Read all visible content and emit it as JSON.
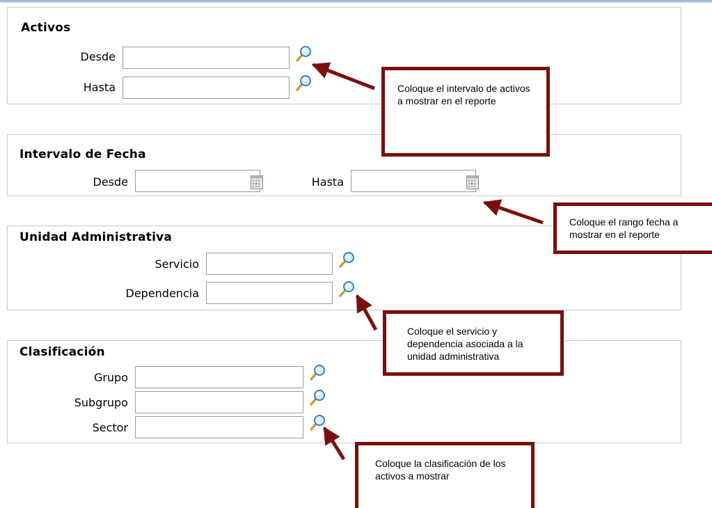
{
  "sections": {
    "activos": {
      "title": "Activos",
      "desde_label": "Desde",
      "hasta_label": "Hasta",
      "desde_value": "",
      "hasta_value": ""
    },
    "fecha": {
      "title": "Intervalo de Fecha",
      "desde_label": "Desde",
      "hasta_label": "Hasta",
      "desde_value": "",
      "hasta_value": ""
    },
    "unidad": {
      "title": "Unidad Administrativa",
      "servicio_label": "Servicio",
      "dependencia_label": "Dependencia",
      "servicio_value": "",
      "dependencia_value": ""
    },
    "clasificacion": {
      "title": "Clasificación",
      "grupo_label": "Grupo",
      "subgrupo_label": "Subgrupo",
      "sector_label": "Sector",
      "grupo_value": "",
      "subgrupo_value": "",
      "sector_value": ""
    }
  },
  "notes": {
    "activos": "Coloque el intervalo de activos a mostrar en el reporte",
    "fecha": "Coloque el rango fecha a mostrar en el reporte",
    "unidad": "Coloque el servicio y dependencia asociada a la unidad administrativa",
    "clasificacion": "Coloque la clasificación de los activos a mostrar"
  },
  "colors": {
    "annotation": "#7a0f0f",
    "panel_border": "#c8c8c8",
    "search_icon": "#3a7fc0"
  },
  "icons": [
    "search-icon",
    "calendar-icon"
  ]
}
